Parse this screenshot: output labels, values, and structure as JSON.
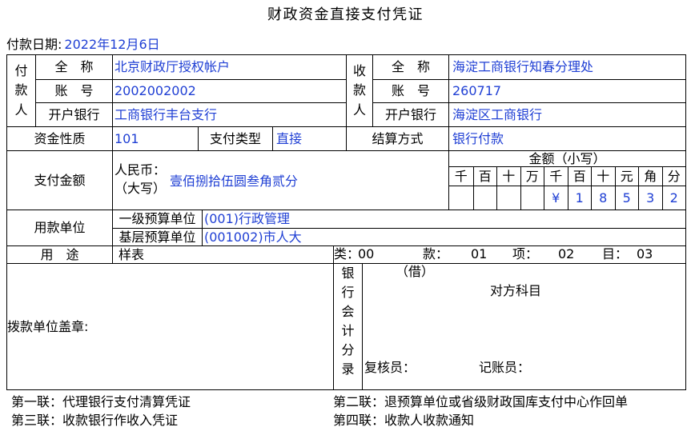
{
  "title": "财政资金直接支付凭证",
  "payment_date": {
    "label": "付款日期:",
    "value": "2022年12月6日"
  },
  "payer": {
    "side_label": "付款人",
    "name_label": "全　称",
    "name": "北京财政厅授权帐户",
    "account_label": "账　号",
    "account": "2002002002",
    "bank_label": "开户银行",
    "bank": "工商银行丰台支行"
  },
  "payee": {
    "side_label": "收款人",
    "name_label": "全　称",
    "name": "海淀工商银行知春分理处",
    "account_label": "账　号",
    "account": "260717",
    "bank_label": "开户银行",
    "bank": "海淀区工商银行"
  },
  "fund_nature": {
    "label": "资金性质",
    "value": "101"
  },
  "payment_type": {
    "label": "支付类型",
    "value": "直接"
  },
  "settlement_method": {
    "label": "结算方式",
    "value": "银行付款"
  },
  "payment_amount": {
    "label": "支付金额",
    "rmb_label": "人民币：",
    "uppercase_label": "（大写）",
    "amount_in_words": "壹佰捌拾伍圆叁角贰分",
    "lowercase_header": "金额（小写）",
    "digit_headers": [
      "千",
      "百",
      "十",
      "万",
      "千",
      "百",
      "十",
      "元",
      "角",
      "分"
    ],
    "digit_values": [
      "",
      "",
      "",
      "",
      "¥",
      "1",
      "8",
      "5",
      "3",
      "2"
    ]
  },
  "using_unit": {
    "label": "用款单位",
    "level1_label": "一级预算单位",
    "level1_value": "(001)行政管理",
    "base_label": "基层预算单位",
    "base_value": "(001002)市人大"
  },
  "purpose": {
    "label": "用　途",
    "value": "样表",
    "classification": [
      {
        "label": "类：",
        "value": "00"
      },
      {
        "label": "款：",
        "value": "01"
      },
      {
        "label": "项：",
        "value": "02"
      },
      {
        "label": "目：",
        "value": "03"
      }
    ]
  },
  "stamp": {
    "label": "拨款单位盖章:"
  },
  "bank_entry": {
    "side_label": "银行会计分录",
    "debit_label": "（借）",
    "counter_account_label": "对方科目",
    "reviewer_label": "复核员：",
    "bookkeeper_label": "记账员："
  },
  "copies": [
    "第一联：代理银行支付清算凭证",
    "第二联：退预算单位或省级财政国库支付中心作回单",
    "第三联：收款银行作收入凭证",
    "第四联：收款人收款通知"
  ],
  "colors": {
    "filled_value": "#1f3fd4",
    "text": "#000000",
    "border": "#000000"
  }
}
